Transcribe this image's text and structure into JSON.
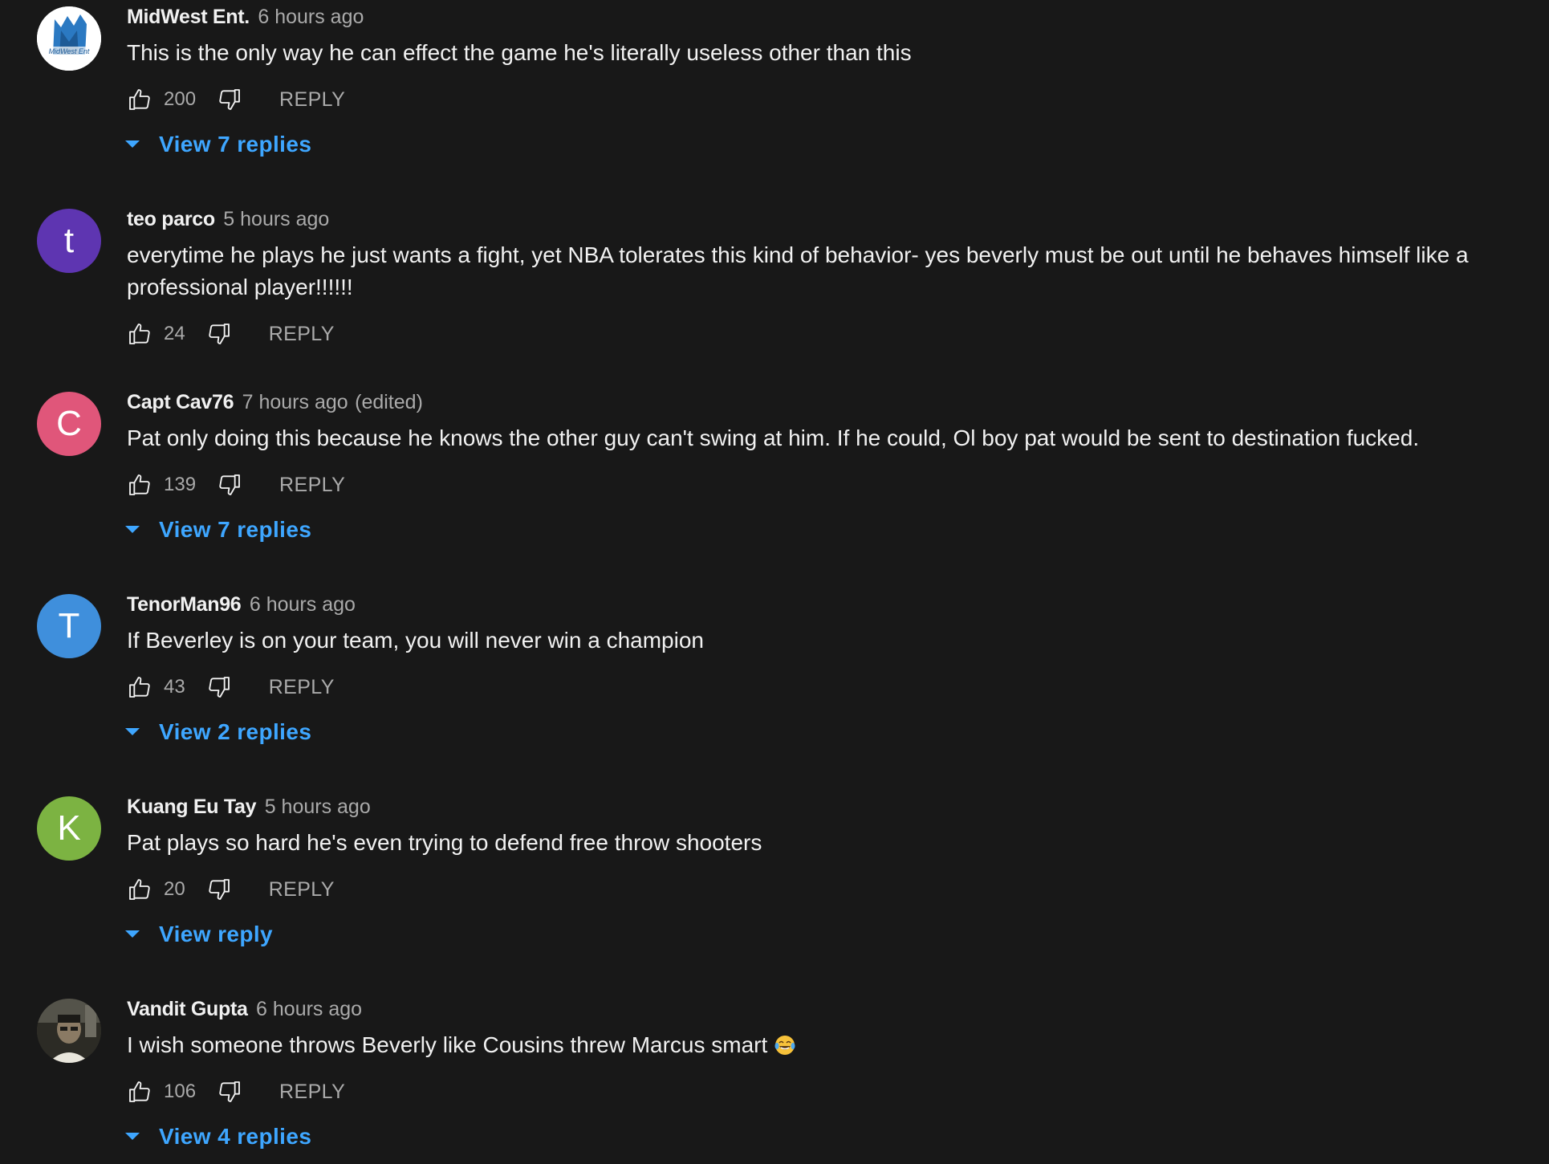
{
  "colors": {
    "background": "#181818",
    "text_primary": "#f1f1f1",
    "text_secondary": "#aaaaaa",
    "link_blue": "#3ea6ff"
  },
  "comments": [
    {
      "author": "MidWest Ent.",
      "time": "6 hours ago",
      "edited": "",
      "text": "This is the only way he can effect the game he's literally useless other than this",
      "likes": "200",
      "reply_label": "REPLY",
      "view_replies": "View 7 replies",
      "avatar": {
        "type": "image",
        "icon": "midwest-ent-logo-icon",
        "text": "MidWest Ent",
        "bg": "#ffffff"
      }
    },
    {
      "author": "teo parco",
      "time": "5 hours ago",
      "edited": "",
      "text": "everytime he plays he just wants a fight, yet NBA tolerates this kind of behavior- yes beverly must be out until he behaves himself like a professional player!!!!!!",
      "likes": "24",
      "reply_label": "REPLY",
      "view_replies": "",
      "avatar": {
        "type": "letter",
        "letter": "t",
        "bg": "#5e35b1"
      }
    },
    {
      "author": "Capt Cav76",
      "time": "7 hours ago",
      "edited": "(edited)",
      "text": "Pat only doing this because he knows the other guy can't swing at him. If he could, Ol boy pat would be sent to destination fucked.",
      "likes": "139",
      "reply_label": "REPLY",
      "view_replies": "View 7 replies",
      "avatar": {
        "type": "letter",
        "letter": "C",
        "bg": "#e0567a"
      }
    },
    {
      "author": "TenorMan96",
      "time": "6 hours ago",
      "edited": "",
      "text": "If Beverley is on your team, you will never win a champion",
      "likes": "43",
      "reply_label": "REPLY",
      "view_replies": "View 2 replies",
      "avatar": {
        "type": "letter",
        "letter": "T",
        "bg": "#3f8fdc"
      }
    },
    {
      "author": "Kuang Eu Tay",
      "time": "5 hours ago",
      "edited": "",
      "text": "Pat plays so hard he's even trying to defend free throw shooters",
      "likes": "20",
      "reply_label": "REPLY",
      "view_replies": "View reply",
      "avatar": {
        "type": "letter",
        "letter": "K",
        "bg": "#7cb342"
      }
    },
    {
      "author": "Vandit Gupta",
      "time": "6 hours ago",
      "edited": "",
      "text": "I wish someone throws Beverly like Cousins threw Marcus smart",
      "emoji": "laughing-tears-emoji-icon",
      "likes": "106",
      "reply_label": "REPLY",
      "view_replies": "View 4 replies",
      "avatar": {
        "type": "image",
        "icon": "user-photo-icon",
        "bg": "#3a3a32"
      }
    }
  ]
}
